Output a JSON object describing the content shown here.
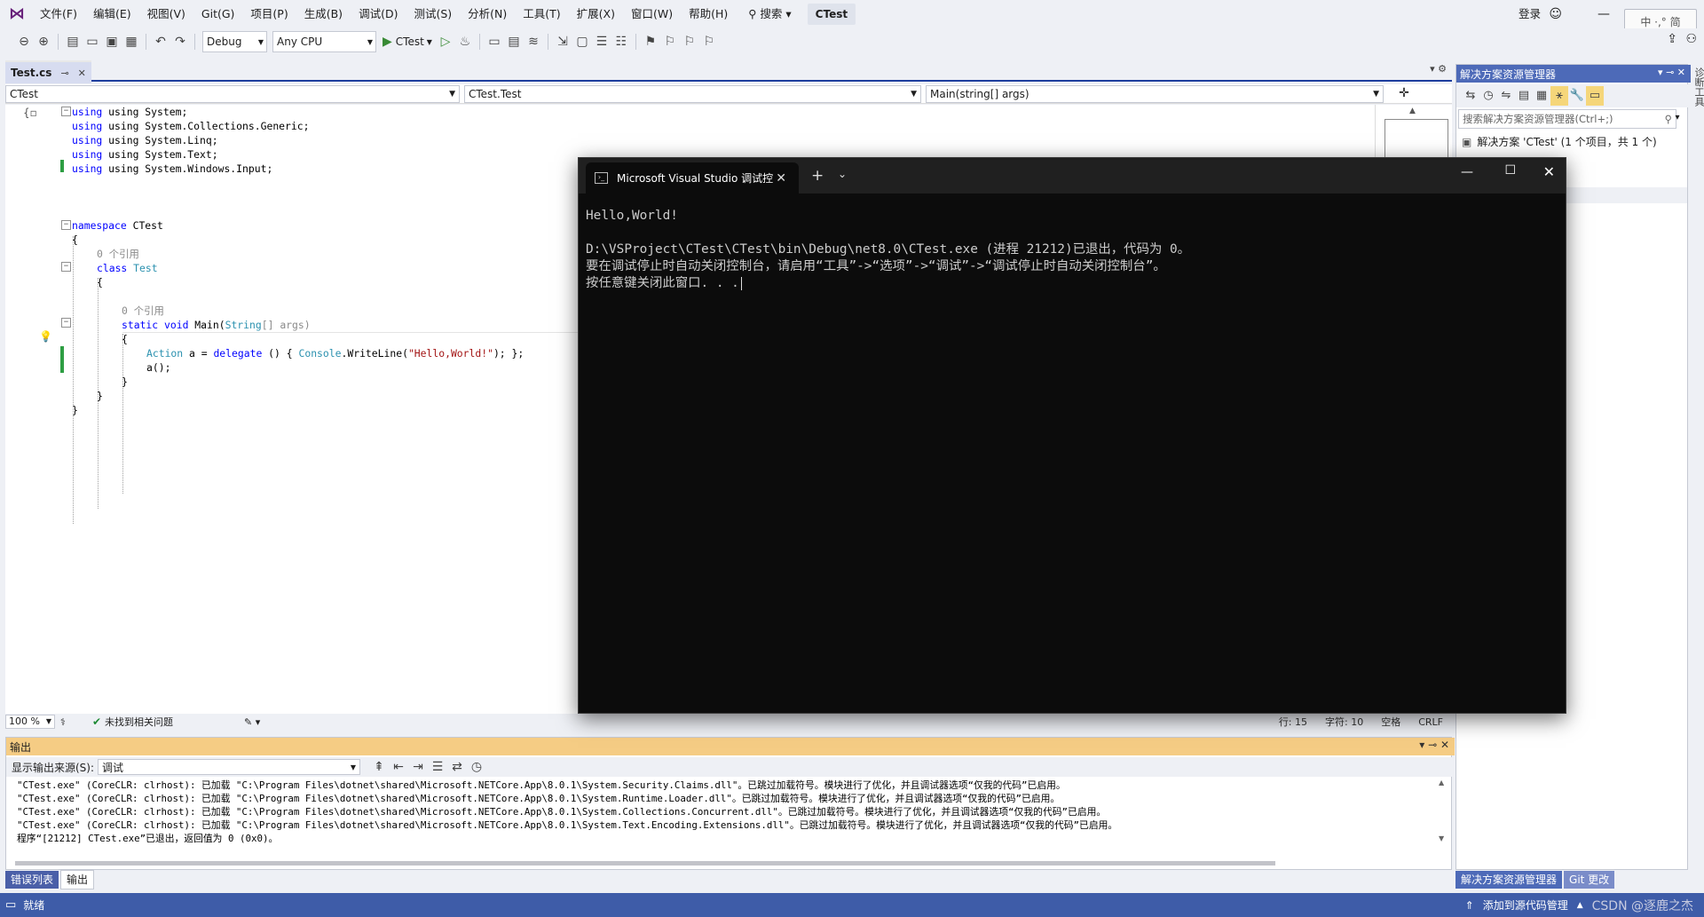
{
  "menu": {
    "items": [
      "文件(F)",
      "编辑(E)",
      "视图(V)",
      "Git(G)",
      "项目(P)",
      "生成(B)",
      "调试(D)",
      "测试(S)",
      "分析(N)",
      "工具(T)",
      "扩展(X)",
      "窗口(W)",
      "帮助(H)"
    ],
    "search": "搜索",
    "solution_name": "CTest",
    "login": "登录",
    "ime": "中 ·,° 简"
  },
  "toolbar": {
    "config": "Debug",
    "platform": "Any CPU",
    "run_target": "CTest"
  },
  "editor_tab": {
    "title": "Test.cs"
  },
  "navbar": {
    "project": "CTest",
    "type": "CTest.Test",
    "member": "Main(string[] args)"
  },
  "code": {
    "l1": "using System;",
    "l2": "using System.Collections.Generic;",
    "l3": "using System.Linq;",
    "l4": "using System.Text;",
    "l5": "using System.Windows.Input;",
    "ns_kw": "namespace",
    "ns_name": "CTest",
    "ref_count_1": "0 个引用",
    "class_kw": "class",
    "class_name": "Test",
    "ref_count_2": "0 个引用",
    "main_kw": "static void",
    "main_name": "Main(",
    "main_param_type": "String",
    "main_param": "[] args)",
    "action_type": "Action",
    "action_rest_1": " a = ",
    "delegate_kw": "delegate",
    "action_rest_2": " () { ",
    "console_type": "Console",
    "action_rest_3": ".WriteLine(",
    "action_str": "\"Hello,World!\"",
    "action_rest_4": "); };",
    "call_line": "a();"
  },
  "editor_status": {
    "zoom": "100 %",
    "issues": "未找到相关问题",
    "line": "行: 15",
    "char": "字符: 10",
    "whitespace": "空格",
    "eol": "CRLF"
  },
  "output": {
    "title": "输出",
    "source_label": "显示输出来源(S):",
    "source_value": "调试",
    "lines": [
      "\"CTest.exe\" (CoreCLR: clrhost): 已加载 \"C:\\Program Files\\dotnet\\shared\\Microsoft.NETCore.App\\8.0.1\\System.Security.Claims.dll\"。已跳过加载符号。模块进行了优化，并且调试器选项“仅我的代码”已启用。",
      "\"CTest.exe\" (CoreCLR: clrhost): 已加载 \"C:\\Program Files\\dotnet\\shared\\Microsoft.NETCore.App\\8.0.1\\System.Runtime.Loader.dll\"。已跳过加载符号。模块进行了优化，并且调试器选项“仅我的代码”已启用。",
      "\"CTest.exe\" (CoreCLR: clrhost): 已加载 \"C:\\Program Files\\dotnet\\shared\\Microsoft.NETCore.App\\8.0.1\\System.Collections.Concurrent.dll\"。已跳过加载符号。模块进行了优化，并且调试器选项“仅我的代码”已启用。",
      "\"CTest.exe\" (CoreCLR: clrhost): 已加载 \"C:\\Program Files\\dotnet\\shared\\Microsoft.NETCore.App\\8.0.1\\System.Text.Encoding.Extensions.dll\"。已跳过加载符号。模块进行了优化，并且调试器选项“仅我的代码”已启用。",
      "程序“[21212] CTest.exe”已退出，返回值为 0 (0x0)。"
    ]
  },
  "bottom_tabs": {
    "errors": "错误列表",
    "output": "输出"
  },
  "solution_explorer": {
    "title": "解决方案资源管理器",
    "search_placeholder": "搜索解决方案资源管理器(Ctrl+;)",
    "root": "解决方案 'CTest' (1 个项目，共 1 个)",
    "tab_active": "解决方案资源管理器",
    "tab_git": "Git 更改"
  },
  "side_strip": {
    "label": "诊断工具"
  },
  "statusbar": {
    "ready": "就绪",
    "add_source": "添加到源代码管理",
    "watermark": "CSDN @逐鹿之杰"
  },
  "console": {
    "tab_title": "Microsoft Visual Studio 调试控",
    "line1": "Hello,World!",
    "line2": "D:\\VSProject\\CTest\\CTest\\bin\\Debug\\net8.0\\CTest.exe (进程 21212)已退出，代码为 0。",
    "line3": "要在调试停止时自动关闭控制台，请启用“工具”->“选项”->“调试”->“调试停止时自动关闭控制台”。",
    "line4": "按任意键关闭此窗口. . ."
  }
}
